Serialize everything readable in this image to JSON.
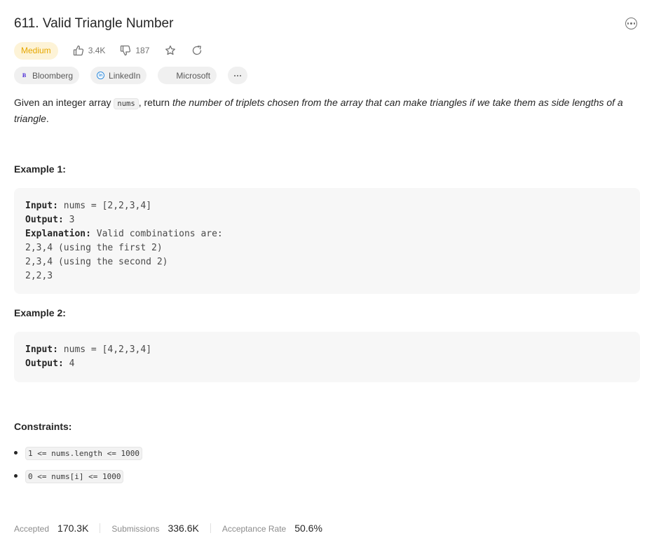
{
  "problem": {
    "title": "611. Valid Triangle Number",
    "difficulty": "Medium",
    "likes": "3.4K",
    "dislikes": "187"
  },
  "tags": [
    {
      "label": "Bloomberg",
      "logo": "B"
    },
    {
      "label": "LinkedIn",
      "logo": "in"
    },
    {
      "label": "Microsoft"
    }
  ],
  "description": {
    "part1": "Given an integer array ",
    "code": "nums",
    "part2": ", return ",
    "emphasis": "the number of triplets chosen from the array that can make triangles if we take them as side lengths of a triangle",
    "part3": "."
  },
  "examples": [
    {
      "title": "Example 1:",
      "input_label": "Input:",
      "input": " nums = [2,2,3,4]",
      "output_label": "Output:",
      "output": " 3",
      "explanation_label": "Explanation:",
      "explanation": " Valid combinations are: ",
      "lines": [
        "2,3,4 (using the first 2)",
        "2,3,4 (using the second 2)",
        "2,2,3"
      ]
    },
    {
      "title": "Example 2:",
      "input_label": "Input:",
      "input": " nums = [4,2,3,4]",
      "output_label": "Output:",
      "output": " 4"
    }
  ],
  "constraints": {
    "title": "Constraints:",
    "items": [
      "1 <= nums.length <= 1000",
      "0 <= nums[i] <= 1000"
    ]
  },
  "stats": {
    "accepted_label": "Accepted",
    "accepted": "170.3K",
    "submissions_label": "Submissions",
    "submissions": "336.6K",
    "rate_label": "Acceptance Rate",
    "rate": "50.6%"
  },
  "colors": {
    "difficulty_bg": "#fdf3d7",
    "difficulty_text": "#e6a700",
    "microsoft": [
      "#f25022",
      "#7fba00",
      "#00a4ef",
      "#ffb900"
    ]
  },
  "icons": [
    "more-icon",
    "thumbs-up-icon",
    "thumbs-down-icon",
    "star-icon",
    "share-icon",
    "bloomberg-logo",
    "linkedin-logo",
    "microsoft-logo",
    "ellipsis-icon"
  ]
}
